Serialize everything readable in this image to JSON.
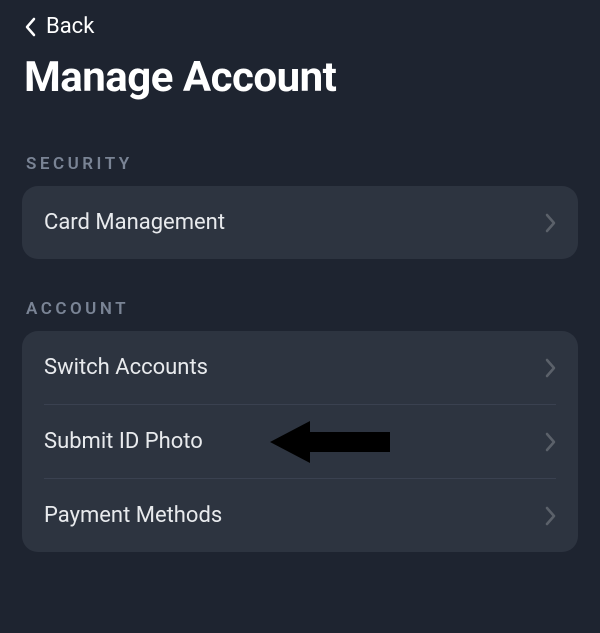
{
  "nav": {
    "back_label": "Back"
  },
  "page": {
    "title": "Manage Account"
  },
  "sections": {
    "security": {
      "header": "SECURITY",
      "items": [
        {
          "label": "Card Management"
        }
      ]
    },
    "account": {
      "header": "ACCOUNT",
      "items": [
        {
          "label": "Switch Accounts"
        },
        {
          "label": "Submit ID Photo"
        },
        {
          "label": "Payment Methods"
        }
      ]
    }
  }
}
